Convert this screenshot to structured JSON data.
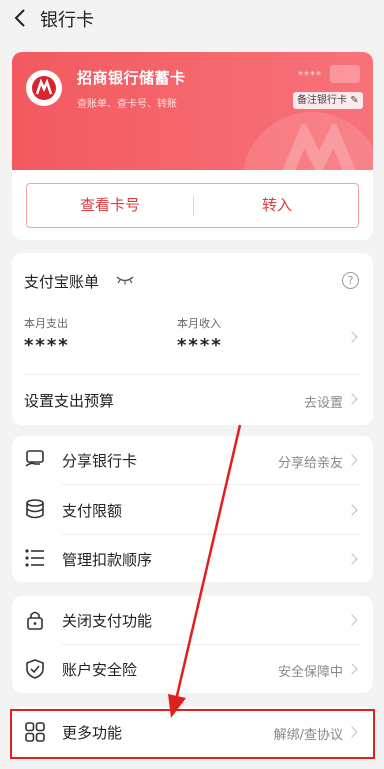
{
  "header": {
    "title": "银行卡"
  },
  "card": {
    "bank_name": "招商银行储蓄卡",
    "subtitle": "查账单、查卡号、转账",
    "masked_number": "****",
    "remark_label": "备注银行卡",
    "view_number_label": "查看卡号",
    "transfer_in_label": "转入",
    "brand_color": "#f25a5f"
  },
  "bill": {
    "title": "支付宝账单",
    "help": "?",
    "expense_label": "本月支出",
    "expense_value": "****",
    "income_label": "本月收入",
    "income_value": "****",
    "budget_label": "设置支出预算",
    "budget_action": "去设置"
  },
  "menu_group1": [
    {
      "label": "分享银行卡",
      "right": "分享给亲友",
      "icon": "share-card-icon"
    },
    {
      "label": "支付限额",
      "right": "",
      "icon": "database-icon"
    },
    {
      "label": "管理扣款顺序",
      "right": "",
      "icon": "list-icon"
    }
  ],
  "menu_group2": [
    {
      "label": "关闭支付功能",
      "right": "",
      "icon": "lock-icon"
    },
    {
      "label": "账户安全险",
      "right": "安全保障中",
      "icon": "shield-icon"
    }
  ],
  "more": {
    "label": "更多功能",
    "right": "解绑/查协议",
    "icon": "grid-icon"
  },
  "colors": {
    "annotation_red": "#e21f1f",
    "accent_red": "#e23b3b"
  }
}
